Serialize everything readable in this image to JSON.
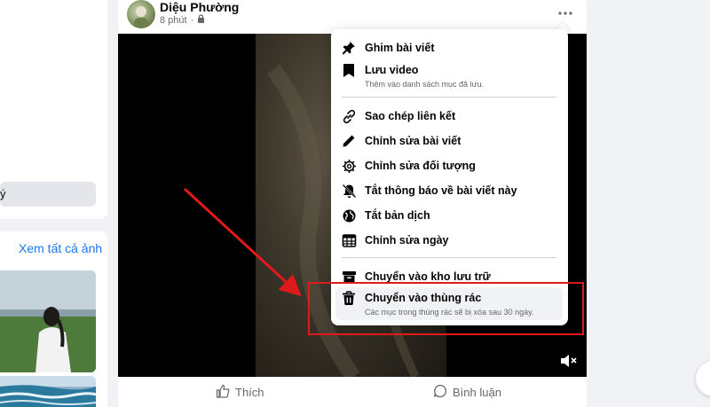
{
  "left": {
    "pill_text": "ý",
    "see_all_photos": "Xem tất cả ảnh"
  },
  "post": {
    "author": "Diệu Phường",
    "time": "8 phút",
    "privacy_icon": "lock-icon",
    "more_icon": "more-horizontal-icon",
    "actions": {
      "like": "Thích",
      "comment": "Bình luận"
    }
  },
  "menu": {
    "items": [
      {
        "icon": "pin-icon",
        "label": "Ghim bài viết"
      },
      {
        "icon": "bookmark-icon",
        "label": "Lưu video",
        "sub": "Thêm vào danh sách mục đã lưu."
      },
      {
        "icon": "link-icon",
        "label": "Sao chép liên kết"
      },
      {
        "icon": "pencil-icon",
        "label": "Chỉnh sửa bài viết"
      },
      {
        "icon": "gear-icon",
        "label": "Chỉnh sửa đối tượng"
      },
      {
        "icon": "bell-off-icon",
        "label": "Tắt thông báo về bài viết này"
      },
      {
        "icon": "globe-icon",
        "label": "Tắt bản dịch"
      },
      {
        "icon": "calendar-icon",
        "label": "Chỉnh sửa ngày"
      },
      {
        "icon": "archive-icon",
        "label": "Chuyển vào kho lưu trữ"
      },
      {
        "icon": "trash-icon",
        "label": "Chuyển vào thùng rác",
        "sub": "Các mục trong thùng rác sẽ bị xóa sau 30 ngày."
      }
    ]
  },
  "colors": {
    "accent": "#1877f2",
    "annotation_red": "#e0191b",
    "background": "#f0f2f5"
  }
}
